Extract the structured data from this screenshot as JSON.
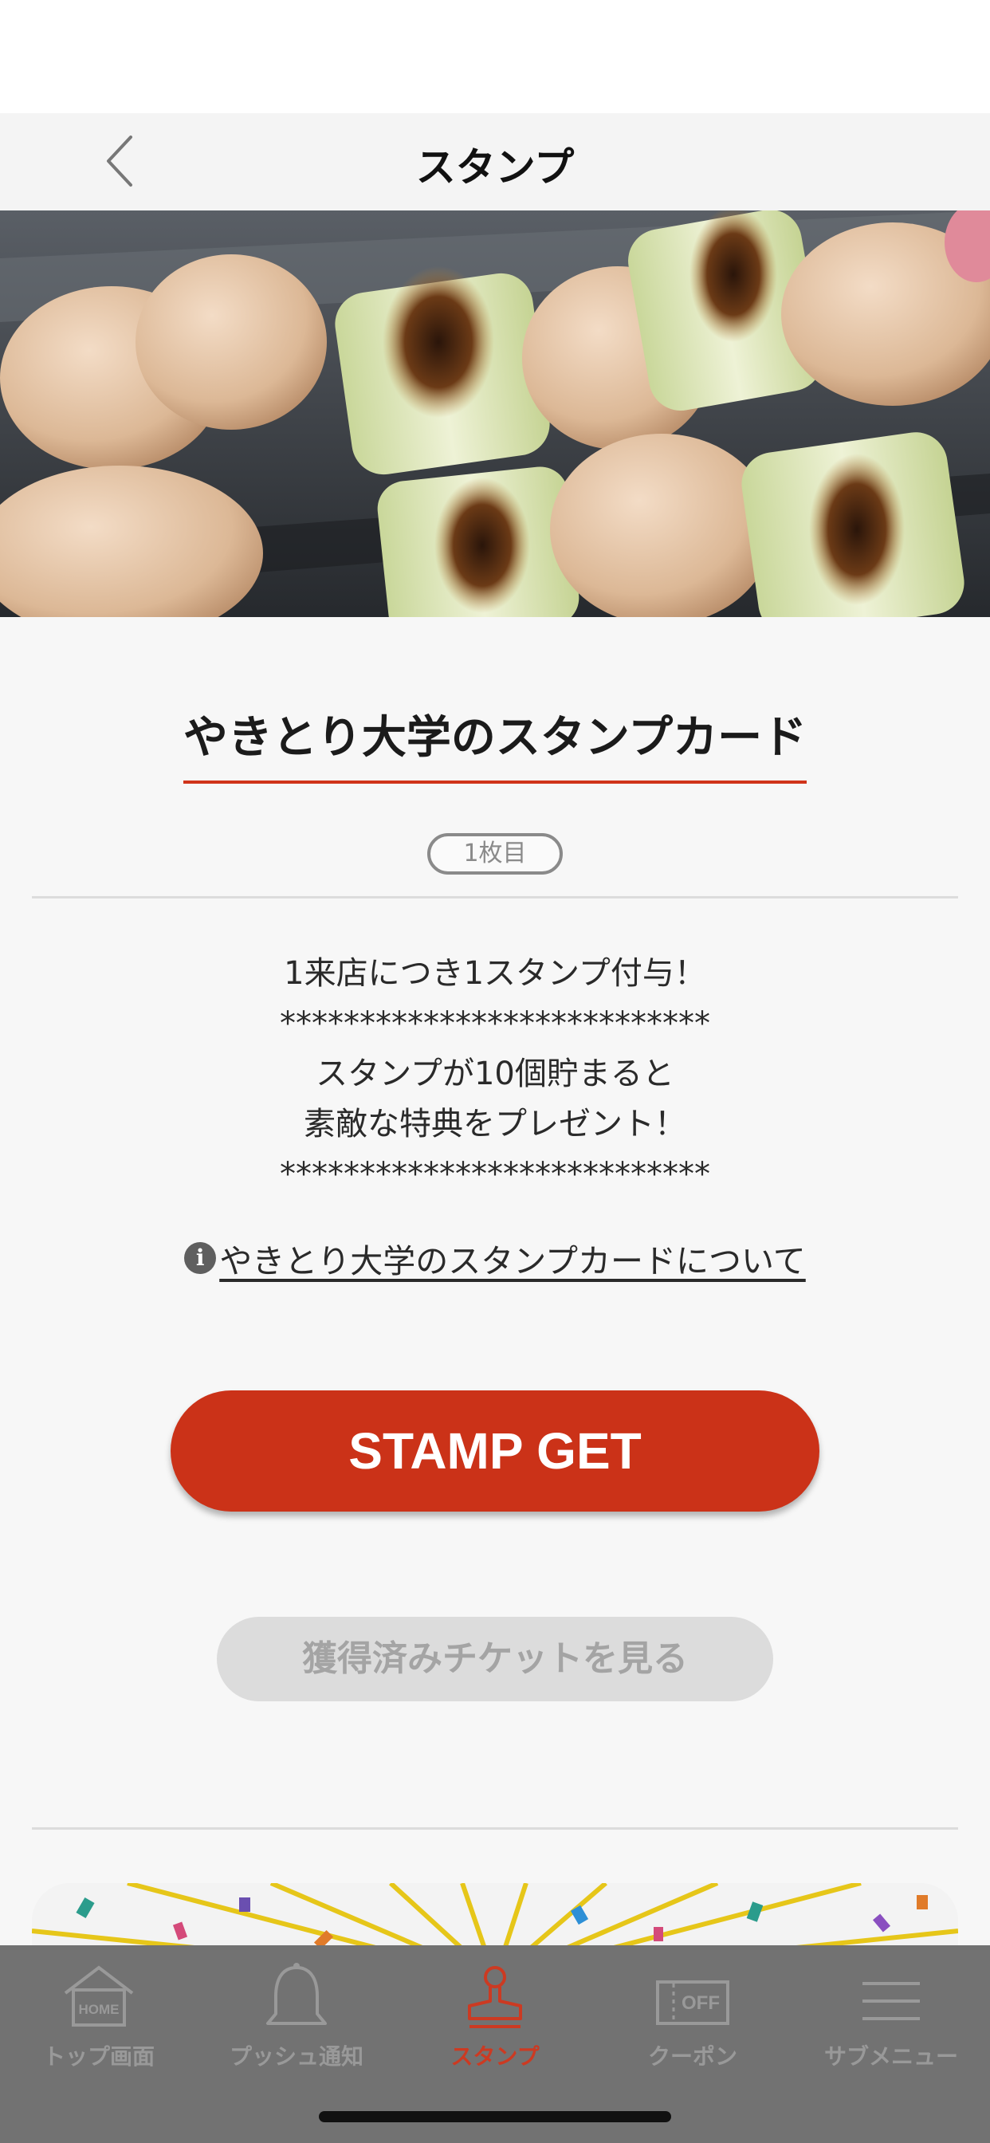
{
  "nav": {
    "title": "スタンプ"
  },
  "card": {
    "title": "やきとり大学のスタンプカード",
    "sheet_badge": "1枚目",
    "description": [
      "1来店につき1スタンプ付与！",
      "***************************",
      "スタンプが10個貯まると",
      "素敵な特典をプレゼント！",
      "***************************"
    ],
    "about_link": "やきとり大学のスタンプカードについて"
  },
  "buttons": {
    "stamp_get": "STAMP GET",
    "view_tickets": "獲得済みチケットを見る"
  },
  "tabbar": {
    "items": [
      {
        "label": "トップ画面",
        "icon": "home-icon",
        "icon_text": "HOME"
      },
      {
        "label": "プッシュ通知",
        "icon": "bell-icon"
      },
      {
        "label": "スタンプ",
        "icon": "stamp-icon",
        "active": true
      },
      {
        "label": "クーポン",
        "icon": "coupon-icon",
        "icon_text": "OFF"
      },
      {
        "label": "サブメニュー",
        "icon": "menu-icon"
      }
    ]
  },
  "colors": {
    "accent": "#cb3218",
    "tab_bar": "#727272",
    "inactive_tab": "#999999",
    "disabled_button": "#dcdcdc"
  }
}
